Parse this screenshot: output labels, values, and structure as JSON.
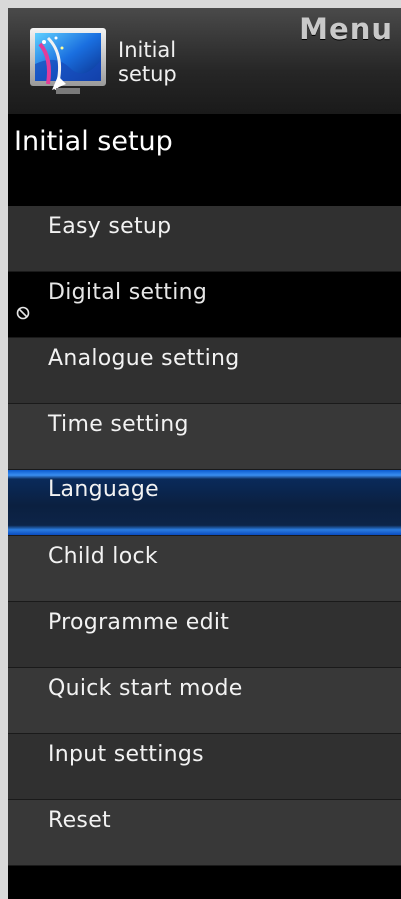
{
  "header": {
    "menu_title": "Menu",
    "caption_line1": "Initial",
    "caption_line2": "setup",
    "icon": "initial-setup-tv-icon"
  },
  "section": {
    "title": "Initial setup"
  },
  "items": [
    {
      "label": "Easy setup",
      "state": "normal"
    },
    {
      "label": "Digital setting",
      "state": "disabled",
      "icon": "prohibited-icon"
    },
    {
      "label": "Analogue setting",
      "state": "normal"
    },
    {
      "label": "Time setting",
      "state": "normal"
    },
    {
      "label": "Language",
      "state": "selected"
    },
    {
      "label": "Child lock",
      "state": "normal"
    },
    {
      "label": "Programme edit",
      "state": "normal"
    },
    {
      "label": "Quick start mode",
      "state": "normal"
    },
    {
      "label": "Input settings",
      "state": "normal"
    },
    {
      "label": "Reset",
      "state": "normal"
    }
  ],
  "colors": {
    "selected": "#0b2040",
    "selected_edge": "#2a7ce0",
    "item_bg": "#303030",
    "text": "#f2f2f2"
  }
}
